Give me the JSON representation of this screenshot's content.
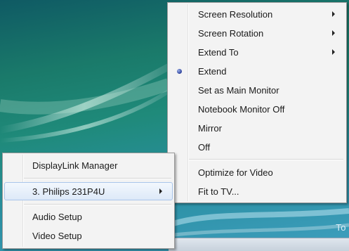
{
  "main_menu": {
    "items": [
      {
        "label": "Screen Resolution",
        "submenu": true
      },
      {
        "label": "Screen Rotation",
        "submenu": true
      },
      {
        "label": "Extend To",
        "submenu": true
      },
      {
        "label": "Extend",
        "checked": true
      },
      {
        "label": "Set as Main Monitor"
      },
      {
        "label": "Notebook Monitor Off"
      },
      {
        "label": "Mirror"
      },
      {
        "label": "Off"
      },
      {
        "label": "Optimize for Video"
      },
      {
        "label": "Fit to TV..."
      }
    ]
  },
  "sub_menu": {
    "items": [
      {
        "label": "DisplayLink Manager"
      },
      {
        "label": "3. Philips 231P4U",
        "submenu": true,
        "highlighted": true
      },
      {
        "label": "Audio Setup"
      },
      {
        "label": "Video Setup"
      }
    ]
  },
  "desktop": {
    "tray_text": "To"
  },
  "colors": {
    "menu_background": "#f3f3f3",
    "highlight": "#dde9f8",
    "desktop": "#1a7a6a"
  }
}
